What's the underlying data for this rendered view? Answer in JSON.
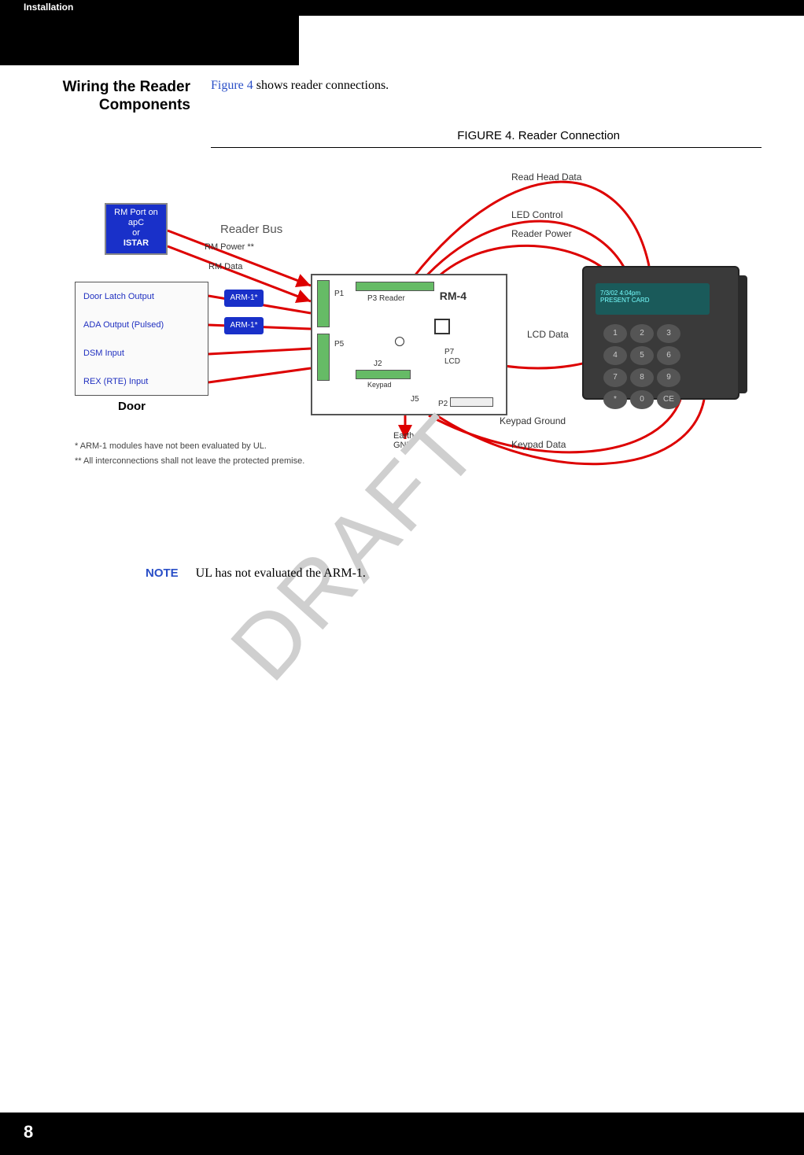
{
  "chapter": "Installation",
  "section_title_line1": "Wiring the Reader",
  "section_title_line2": "Components",
  "intro_link": "Figure 4",
  "intro_text": " shows reader connections.",
  "figure_caption": "FIGURE 4.  Reader Connection",
  "diagram": {
    "rm_port": {
      "l1": "RM Port on",
      "l2": "apC",
      "l3": "or",
      "l4": "ISTAR"
    },
    "reader_bus": "Reader Bus",
    "rm_power": "RM Power **",
    "rm_data": "RM Data",
    "door_items": [
      "Door Latch Output",
      "ADA Output (Pulsed)",
      "DSM Input",
      "REX (RTE) Input"
    ],
    "door_title": "Door",
    "arm_label": "ARM-1*",
    "rm4_title": "RM-4",
    "ports": {
      "p1": "P1",
      "p3": "P3 Reader",
      "p5": "P5",
      "p7": "P7",
      "lcd": "LCD",
      "j2": "J2",
      "keypad_conn": "Keypad",
      "j5": "J5",
      "p2": "P2"
    },
    "earth_gnd": "Earth\nGND",
    "right_labels": {
      "read_head": "Read Head Data",
      "led_control": "LED Control",
      "reader_power": "Reader Power",
      "lcd_data": "LCD Data",
      "keypad_ground": "Keypad Ground",
      "keypad_data": "Keypad Data"
    },
    "keypad_screen": {
      "l1": "7/3/02   4:04pm",
      "l2": "PRESENT CARD"
    },
    "keypad_keys": [
      "1",
      "2",
      "3",
      "4",
      "5",
      "6",
      "7",
      "8",
      "9",
      "*",
      "0",
      "CE"
    ],
    "footnote1": "*  ARM-1 modules have not been evaluated by UL.",
    "footnote2": "** All interconnections shall not leave the protected premise."
  },
  "watermark": "DRAFT",
  "note_label": "NOTE",
  "note_text": "UL has not evaluated the ARM-1.",
  "page_number": "8"
}
